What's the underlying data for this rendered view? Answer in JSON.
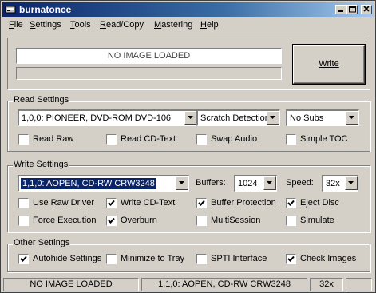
{
  "window": {
    "title": "burnatonce"
  },
  "menu": [
    {
      "label": "File",
      "mnemonic": "F"
    },
    {
      "label": "Settings",
      "mnemonic": "S"
    },
    {
      "label": "Tools",
      "mnemonic": "T"
    },
    {
      "label": "Read/Copy",
      "mnemonic": "R"
    },
    {
      "label": "Mastering",
      "mnemonic": "M"
    },
    {
      "label": "Help",
      "mnemonic": "H"
    }
  ],
  "top": {
    "image_status": "NO IMAGE LOADED",
    "write_button": "Write",
    "progress": 0
  },
  "read_settings": {
    "title": "Read Settings",
    "drive": "1,0,0: PIONEER, DVD-ROM DVD-106",
    "read_mode": "Scratch Detection",
    "subs": "No Subs",
    "checkboxes": [
      {
        "label": "Read Raw",
        "checked": false
      },
      {
        "label": "Read CD-Text",
        "checked": false
      },
      {
        "label": "Swap Audio",
        "checked": false
      },
      {
        "label": "Simple TOC",
        "checked": false
      }
    ]
  },
  "write_settings": {
    "title": "Write Settings",
    "drive": "1,1,0: AOPEN, CD-RW CRW3248",
    "buffers_label": "Buffers:",
    "buffers_value": "1024",
    "speed_label": "Speed:",
    "speed_value": "32x",
    "checkboxes": [
      {
        "label": "Use Raw Driver",
        "checked": false
      },
      {
        "label": "Write CD-Text",
        "checked": true
      },
      {
        "label": "Buffer Protection",
        "checked": true
      },
      {
        "label": "Eject Disc",
        "checked": true
      },
      {
        "label": "Force Execution",
        "checked": false
      },
      {
        "label": "Overburn",
        "checked": true
      },
      {
        "label": "MultiSession",
        "checked": false
      },
      {
        "label": "Simulate",
        "checked": false
      }
    ]
  },
  "other_settings": {
    "title": "Other Settings",
    "checkboxes": [
      {
        "label": "Autohide Settings",
        "checked": true
      },
      {
        "label": "Minimize to Tray",
        "checked": false
      },
      {
        "label": "SPTI Interface",
        "checked": false
      },
      {
        "label": "Check Images",
        "checked": true
      }
    ]
  },
  "status": {
    "image": "NO IMAGE LOADED",
    "drive": "1,1,0: AOPEN, CD-RW CRW3248",
    "speed": "32x"
  }
}
